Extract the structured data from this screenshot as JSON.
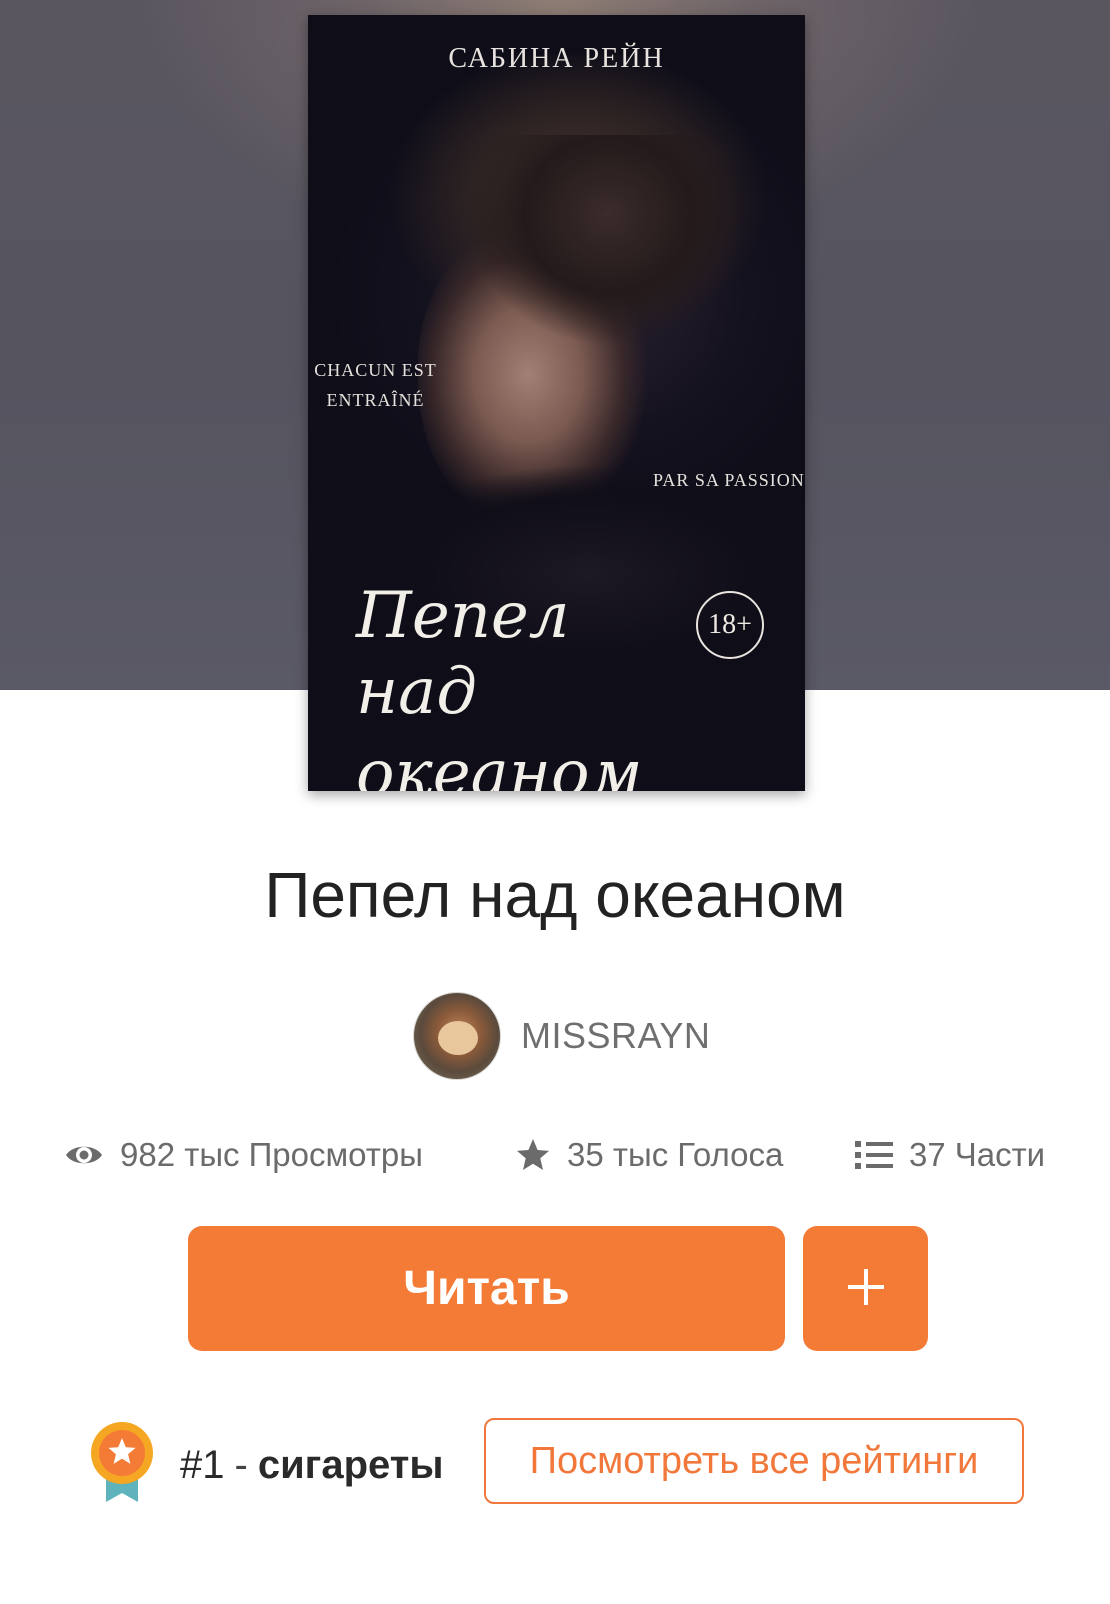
{
  "cover": {
    "author": "САБИНА РЕЙН",
    "phrase_left": "Chacun est entraîné",
    "phrase_right": "par sa passion",
    "title_line1": "Пепел",
    "title_line2": "над океаном",
    "age_rating": "18+"
  },
  "story": {
    "title": "Пепел над океаном"
  },
  "author": {
    "username": "MISSRAYN"
  },
  "stats": {
    "views": {
      "value": "982 тыс",
      "label": "Просмотры",
      "icon": "eye-icon"
    },
    "votes": {
      "value": "35 тыс",
      "label": "Голоса",
      "icon": "star-icon"
    },
    "parts": {
      "value": "37",
      "label": "Части",
      "icon": "list-icon"
    }
  },
  "actions": {
    "read_label": "Читать",
    "add_label": "+"
  },
  "ranking": {
    "rank": "#1",
    "separator": "-",
    "tag": "сигареты",
    "view_all_label": "Посмотреть все рейтинги",
    "badge_icon": "ranking-medal-icon"
  },
  "colors": {
    "accent": "#f47b36",
    "text_primary": "#222222",
    "text_secondary": "#6b6b6b"
  }
}
